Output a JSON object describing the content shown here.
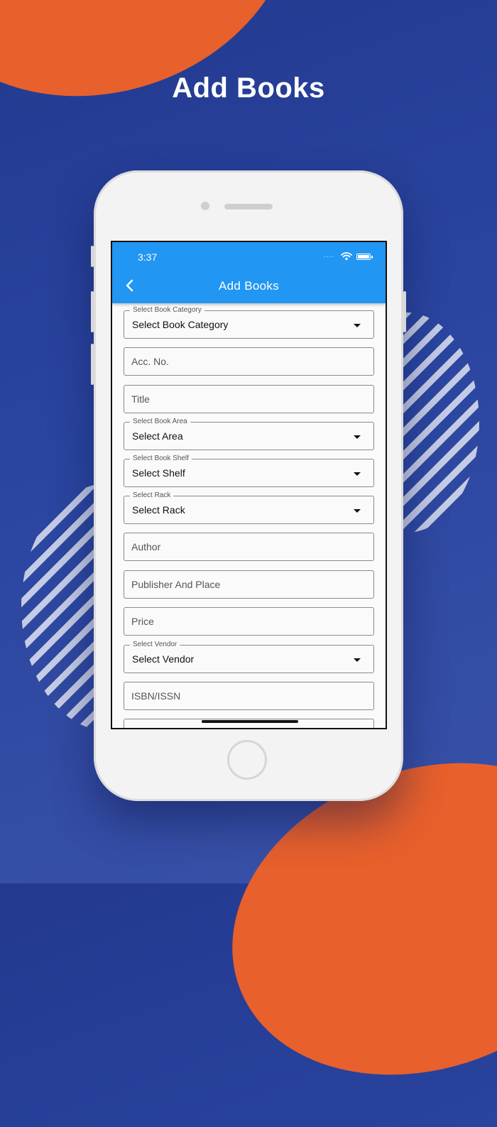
{
  "headline": "Add Books",
  "status_bar": {
    "time": "3:37",
    "signal": "....",
    "icons": [
      "wifi-icon",
      "battery-icon"
    ]
  },
  "appbar": {
    "title": "Add Books",
    "back_icon": "chevron-left-icon"
  },
  "form": {
    "book_category": {
      "floating_label": "Select Book Category",
      "value": "Select Book Category"
    },
    "acc_no": {
      "placeholder": "Acc. No."
    },
    "title": {
      "placeholder": "Title"
    },
    "book_area": {
      "floating_label": "Select Book Area",
      "value": "Select Area"
    },
    "book_shelf": {
      "floating_label": "Select Book Shelf",
      "value": "Select Shelf"
    },
    "rack": {
      "floating_label": "Select Rack",
      "value": "Select Rack"
    },
    "author": {
      "placeholder": "Author"
    },
    "publisher": {
      "placeholder": "Publisher And Place"
    },
    "price": {
      "placeholder": "Price"
    },
    "vendor": {
      "floating_label": "Select Vendor",
      "value": "Select Vendor"
    },
    "isbn": {
      "placeholder": "ISBN/ISSN"
    }
  },
  "colors": {
    "appbar": "#2196f3",
    "background": "#2a45a0",
    "accent": "#e8602c"
  }
}
